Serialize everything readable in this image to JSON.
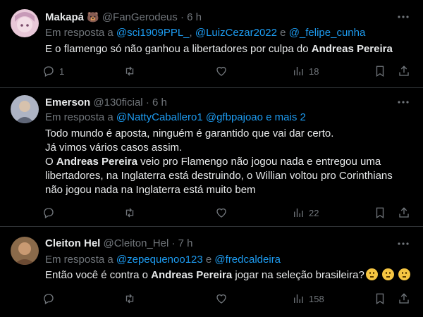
{
  "tweets": [
    {
      "name": "Makapá",
      "badge": "🐻",
      "handle": "@FanGerodeus",
      "time": "· 6 h",
      "reply_prefix": "Em resposta a",
      "mentions": [
        "@sci1909PPL_",
        "@LuizCezar2022",
        "@_felipe_cunha"
      ],
      "sep_1": "e",
      "text_1": "E o flamengo só não ganhou a libertadores por culpa do ",
      "text_bold_1": "Andreas Pereira",
      "replies": "1",
      "retweets": "",
      "likes": "",
      "views": "18"
    },
    {
      "name": "Emerson",
      "handle": "@130ficial",
      "time": "· 6 h",
      "reply_prefix": "Em resposta a",
      "mentions": [
        "@NattyCaballero1",
        "@gfbpajoao",
        "e mais 2"
      ],
      "line_1": "Todo mundo é aposta, ninguém é garantido que vai dar certo.",
      "line_2": "Já vimos vários casos assim.",
      "line_3_pre": "O ",
      "line_3_bold": "Andreas Pereira",
      "line_3_post": " veio pro Flamengo não jogou nada e entregou uma",
      "line_4": "libertadores, na Inglaterra está destruindo, o Willian voltou pro Corinthians",
      "line_5": "não jogou nada na Inglaterra está muito bem",
      "replies": "",
      "retweets": "",
      "likes": "",
      "views": "22"
    },
    {
      "name": "Cleiton Hel",
      "handle": "@Cleiton_Hel",
      "time": "· 7 h",
      "reply_prefix": "Em resposta a",
      "mentions": [
        "@zepequenoo123",
        "@fredcaldeira"
      ],
      "sep_1": "e",
      "text_pre": "Então você é contra o ",
      "text_bold": "Andreas Pereira",
      "text_post": " jogar na seleção brasileira?",
      "emojis": [
        "thinking-face",
        "thinking-face",
        "thinking-face"
      ],
      "replies": "",
      "retweets": "",
      "likes": "",
      "views": "158"
    }
  ],
  "colors": {
    "background": "#000000",
    "text": "#e7e9ea",
    "muted": "#71767b",
    "link": "#1d9bf0",
    "divider": "#2f3336"
  },
  "icons": [
    "more-icon",
    "reply-icon",
    "retweet-icon",
    "like-icon",
    "views-icon",
    "bookmark-icon",
    "share-icon"
  ]
}
